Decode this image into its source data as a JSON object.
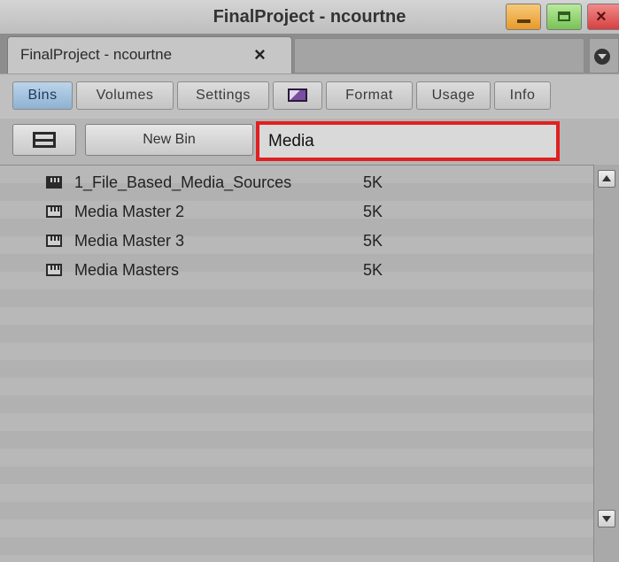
{
  "window": {
    "title": "FinalProject - ncourtne",
    "minimize_icon": "minimize-icon",
    "maximize_icon": "maximize-icon",
    "close_icon": "close-icon"
  },
  "project_tab": {
    "label": "FinalProject - ncourtne",
    "close_glyph": "×",
    "menu_icon": "tab-menu-icon"
  },
  "subtabs": [
    {
      "label": "Bins",
      "active": true
    },
    {
      "label": "Volumes",
      "active": false
    },
    {
      "label": "Settings",
      "active": false
    },
    {
      "label": "",
      "icon": "color-swatch-icon",
      "active": false
    },
    {
      "label": "Format",
      "active": false
    },
    {
      "label": "Usage",
      "active": false
    },
    {
      "label": "Info",
      "active": false
    }
  ],
  "toolbar": {
    "view_toggle_icon": "view-toggle-icon",
    "new_bin_label": "New Bin",
    "search_value": "Media"
  },
  "bins": [
    {
      "name": "1_File_Based_Media_Sources",
      "size": "5K",
      "icon": "bin-open-icon"
    },
    {
      "name": "Media Master 2",
      "size": "5K",
      "icon": "bin-icon"
    },
    {
      "name": "Media Master 3",
      "size": "5K",
      "icon": "bin-icon"
    },
    {
      "name": "Media Masters",
      "size": "5K",
      "icon": "bin-icon"
    }
  ],
  "colors": {
    "search_highlight": "#e02020",
    "active_tab": "#8eb2d2"
  }
}
